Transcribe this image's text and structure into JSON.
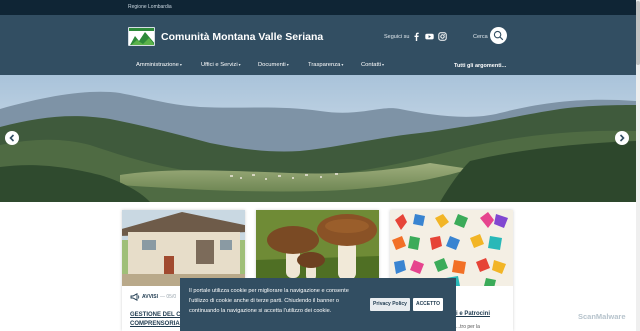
{
  "topbar": {
    "region": "Regione Lombardia"
  },
  "header": {
    "title": "Comunità Montana Valle Seriana",
    "social_label": "Seguici su",
    "search_label": "Cerca",
    "icons": [
      "facebook-icon",
      "youtube-icon",
      "instagram-icon",
      "search-icon"
    ]
  },
  "nav": {
    "items": [
      {
        "label": "Amministrazione"
      },
      {
        "label": "Uffici e Servizi"
      },
      {
        "label": "Documenti"
      },
      {
        "label": "Trasparenza"
      },
      {
        "label": "Contatti"
      }
    ],
    "all_topics": "Tutti gli argomenti..."
  },
  "cards": [
    {
      "category": "AVVISI",
      "separator": "— 05/0",
      "title": "GESTIONE DEL CAN... COMPRENSORIALE..."
    },
    {
      "category": "",
      "title": ""
    },
    {
      "category": "",
      "title": "...i e Patrocini",
      "text": "...tro per la"
    }
  ],
  "cookie": {
    "text": "Il portale utilizza cookie per migliorare la navigazione e consente l'utilizzo di cookie anche di terze parti. Chiudendo il banner o continuando la navigazione si accetta l'utilizzo dei cookie.",
    "privacy_label": "Privacy Policy",
    "accept_label": "ACCETTO"
  },
  "watermark": "ScanMalware",
  "colors": {
    "header": "#324e62",
    "topbar": "#0f2535",
    "accent": "#1e3a4f"
  }
}
